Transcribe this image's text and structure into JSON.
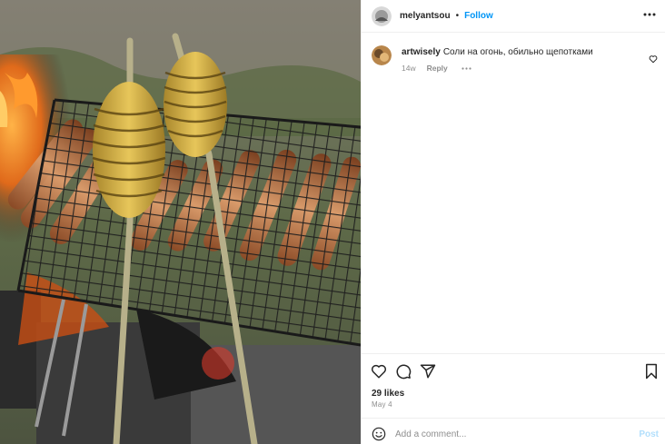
{
  "post": {
    "username": "melyantsou",
    "separator": "•",
    "follow_label": "Follow",
    "more_icon": "more-horizontal-icon"
  },
  "comments": [
    {
      "username": "artwisely",
      "text": "Соли на огонь, обильно щепотками",
      "age": "14w",
      "reply_label": "Reply"
    }
  ],
  "actions": {
    "like_icon": "heart-icon",
    "comment_icon": "comment-icon",
    "share_icon": "send-icon",
    "save_icon": "bookmark-icon"
  },
  "likes_text": "29 likes",
  "date_text": "May 4",
  "add_comment": {
    "placeholder": "Add a comment...",
    "post_label": "Post"
  },
  "colors": {
    "accent": "#0095f6",
    "post_disabled": "#b2dffc",
    "muted": "#8e8e8e"
  }
}
